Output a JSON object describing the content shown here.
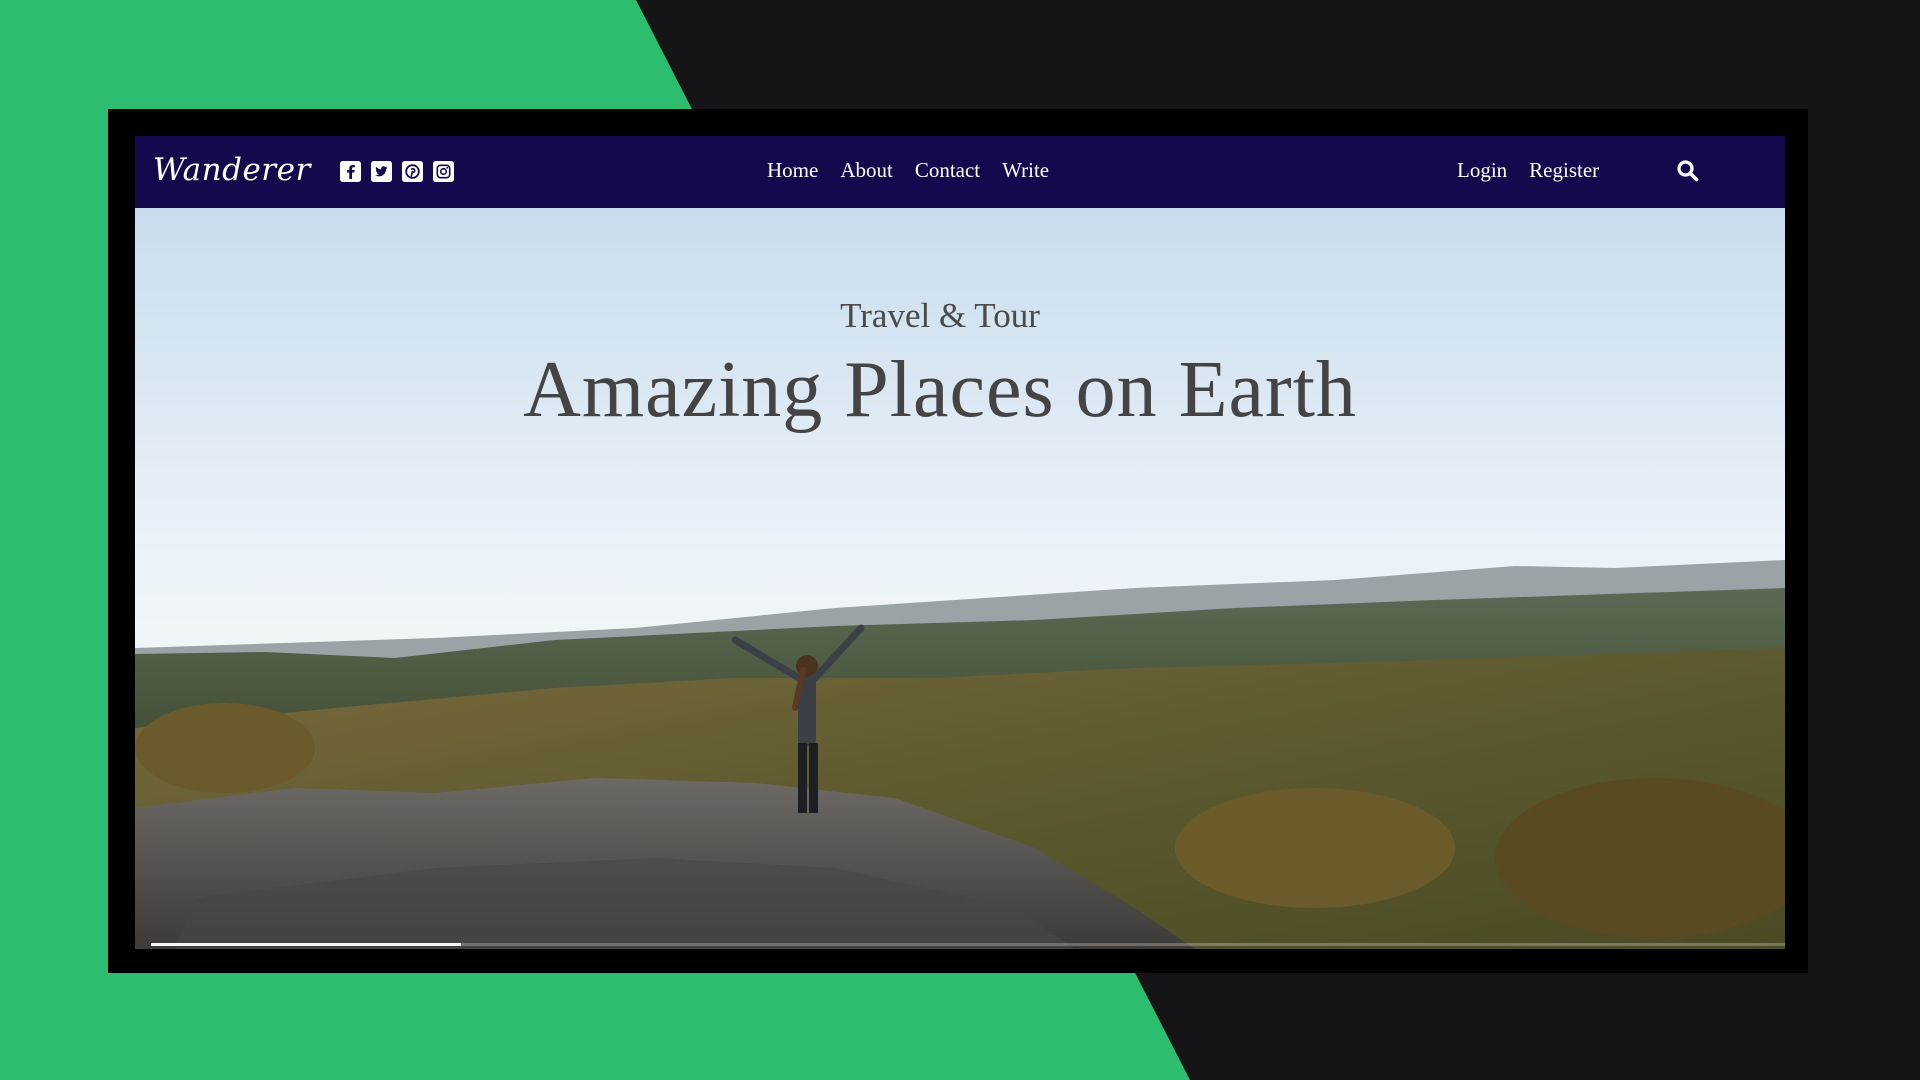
{
  "brand": {
    "name": "Wanderer"
  },
  "social": [
    {
      "icon": "facebook-icon"
    },
    {
      "icon": "twitter-icon"
    },
    {
      "icon": "pinterest-icon"
    },
    {
      "icon": "instagram-icon"
    }
  ],
  "nav": {
    "center": [
      "Home",
      "About",
      "Contact",
      "Write"
    ],
    "right": [
      "Login",
      "Register"
    ],
    "search_icon": "search-icon"
  },
  "hero": {
    "subtitle": "Travel & Tour",
    "title": "Amazing Places on Earth",
    "progress": 0.19
  },
  "colors": {
    "navbar": "#13094c",
    "background_green": "#2dbd6e",
    "background_dark": "#151517"
  }
}
